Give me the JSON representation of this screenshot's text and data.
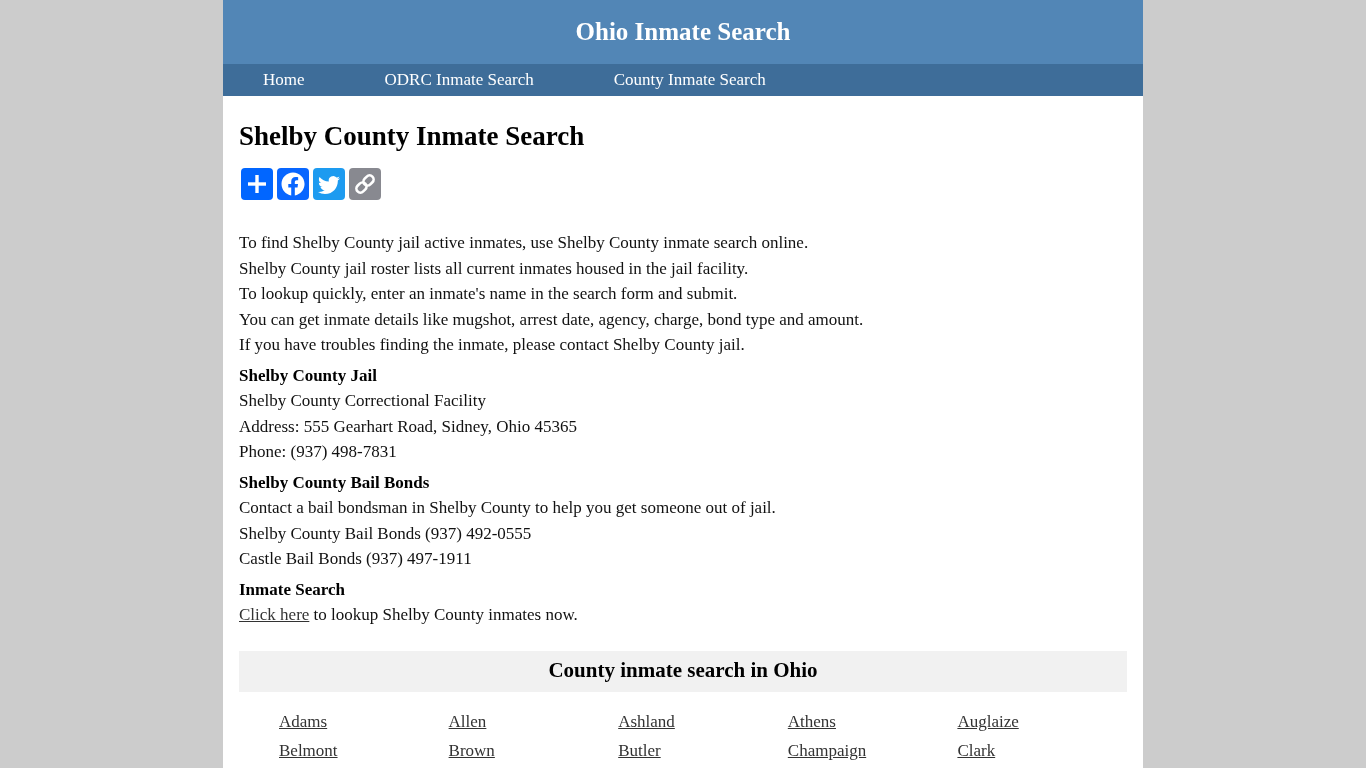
{
  "header": {
    "title": "Ohio Inmate Search"
  },
  "nav": [
    {
      "label": "Home"
    },
    {
      "label": "ODRC Inmate Search"
    },
    {
      "label": "County Inmate Search"
    }
  ],
  "page_title": "Shelby County Inmate Search",
  "intro": [
    "To find Shelby County jail active inmates, use Shelby County inmate search online.",
    "Shelby County jail roster lists all current inmates housed in the jail facility.",
    "To lookup quickly, enter an inmate's name in the search form and submit.",
    "You can get inmate details like mugshot, arrest date, agency, charge, bond type and amount.",
    "If you have troubles finding the inmate, please contact Shelby County jail."
  ],
  "sections": [
    {
      "heading": "Shelby County Jail",
      "lines": [
        {
          "kind": "text",
          "text": "Shelby County Correctional Facility"
        },
        {
          "kind": "text",
          "text": "Address: 555 Gearhart Road, Sidney, Ohio 45365"
        },
        {
          "kind": "text",
          "text": "Phone: (937) 498-7831"
        }
      ]
    },
    {
      "heading": "Shelby County Bail Bonds",
      "lines": [
        {
          "kind": "text",
          "text": "Contact a bail bondsman in Shelby County to help you get someone out of jail."
        },
        {
          "kind": "text",
          "text": "Shelby County Bail Bonds (937) 492-0555"
        },
        {
          "kind": "text",
          "text": "Castle Bail Bonds (937) 497-1911"
        }
      ]
    },
    {
      "heading": "Inmate Search",
      "lines": [
        {
          "kind": "link_text",
          "link": "Click here",
          "text": "to lookup Shelby County inmates now."
        }
      ]
    }
  ],
  "county_directory": {
    "title": "County inmate search in Ohio",
    "counties": [
      "Adams",
      "Allen",
      "Ashland",
      "Athens",
      "Auglaize",
      "Belmont",
      "Brown",
      "Butler",
      "Champaign",
      "Clark"
    ]
  }
}
